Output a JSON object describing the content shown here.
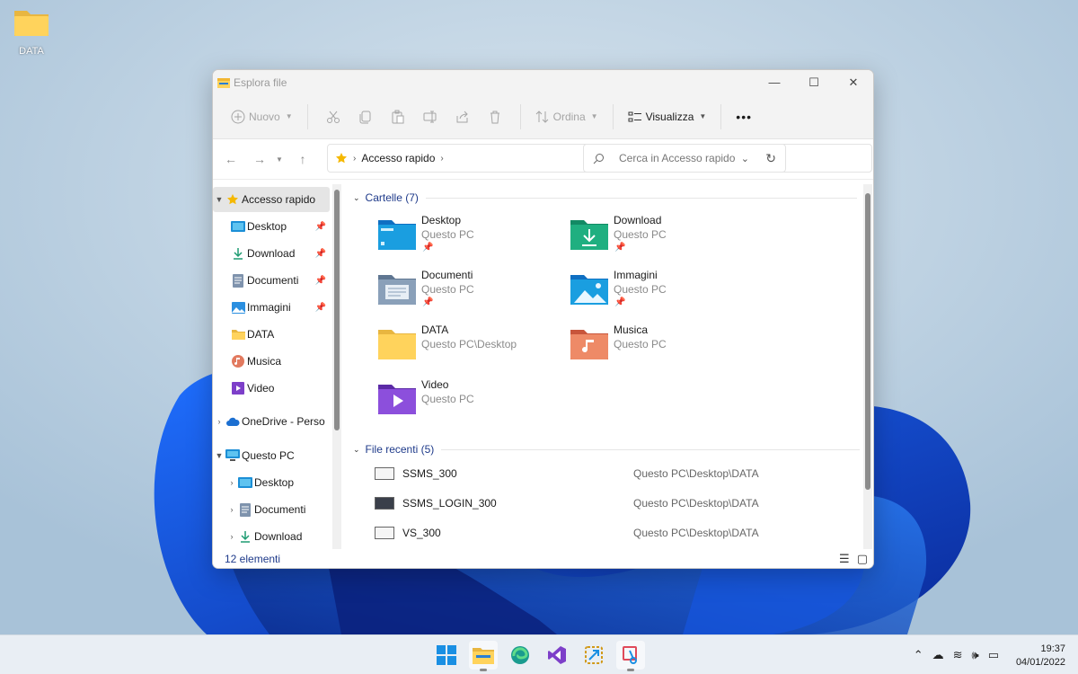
{
  "desktop": {
    "icon_label": "DATA"
  },
  "window": {
    "title": "Esplora file",
    "controls": {
      "minimize": "—",
      "maximize": "☐",
      "close": "✕"
    }
  },
  "toolbar": {
    "new_label": "Nuovo",
    "sort_label": "Ordina",
    "view_label": "Visualizza",
    "more_label": "•••"
  },
  "address": {
    "crumb": "Accesso rapido",
    "search_placeholder": "Cerca in Accesso rapido"
  },
  "sidebar": {
    "items": [
      {
        "label": "Accesso rapido",
        "icon": "star-icon"
      },
      {
        "label": "Desktop",
        "icon": "desktop-icon"
      },
      {
        "label": "Download",
        "icon": "download-icon"
      },
      {
        "label": "Documenti",
        "icon": "documents-icon"
      },
      {
        "label": "Immagini",
        "icon": "pictures-icon"
      },
      {
        "label": "DATA",
        "icon": "folder-icon"
      },
      {
        "label": "Musica",
        "icon": "music-icon"
      },
      {
        "label": "Video",
        "icon": "video-icon"
      },
      {
        "label": "OneDrive - Perso",
        "icon": "onedrive-icon"
      },
      {
        "label": "Questo PC",
        "icon": "pc-icon"
      },
      {
        "label": "Desktop",
        "icon": "desktop-icon"
      },
      {
        "label": "Documenti",
        "icon": "documents-icon"
      },
      {
        "label": "Download",
        "icon": "download-icon"
      }
    ]
  },
  "content": {
    "folders_header": "Cartelle (7)",
    "folders": [
      {
        "name": "Desktop",
        "location": "Questo PC",
        "pinned": true
      },
      {
        "name": "Download",
        "location": "Questo PC",
        "pinned": true
      },
      {
        "name": "Documenti",
        "location": "Questo PC",
        "pinned": true
      },
      {
        "name": "Immagini",
        "location": "Questo PC",
        "pinned": true
      },
      {
        "name": "DATA",
        "location": "Questo PC\\Desktop",
        "pinned": false
      },
      {
        "name": "Musica",
        "location": "Questo PC",
        "pinned": false
      },
      {
        "name": "Video",
        "location": "Questo PC",
        "pinned": false
      }
    ],
    "recent_header": "File recenti (5)",
    "recent": [
      {
        "name": "SSMS_300",
        "path": "Questo PC\\Desktop\\DATA"
      },
      {
        "name": "SSMS_LOGIN_300",
        "path": "Questo PC\\Desktop\\DATA"
      },
      {
        "name": "VS_300",
        "path": "Questo PC\\Desktop\\DATA"
      }
    ]
  },
  "status": {
    "count": "12 elementi"
  },
  "taskbar": {
    "time": "19:37",
    "date": "04/01/2022"
  }
}
